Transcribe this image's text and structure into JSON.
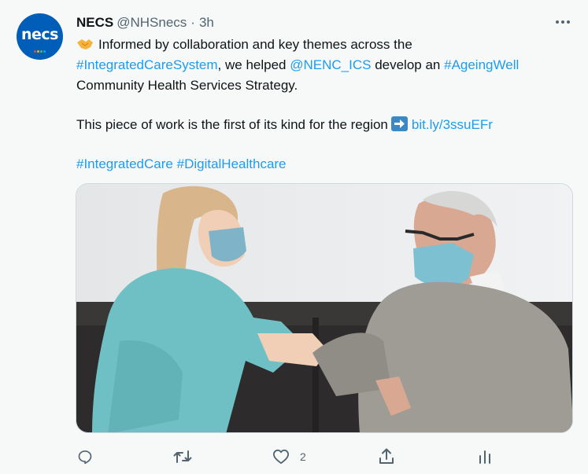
{
  "tweet": {
    "avatar_text": "necs",
    "author_name": "NECS",
    "handle": "@NHSnecs",
    "separator": "·",
    "time": "3h",
    "line1_text": "Informed by collaboration and key themes across the",
    "hashtag_ics": "#IntegratedCareSystem",
    "line2_mid": ", we helped ",
    "mention": "@NENC_ICS",
    "line2_mid2": " develop an ",
    "hashtag_ageing": "#AgeingWell",
    "line3_text": "Community Health Services Strategy.",
    "para2_text": "This piece of work is the first of its kind for the region",
    "link": "bit.ly/3ssuEFr",
    "hashtag_integrated": "#IntegratedCare",
    "hashtag_digital": "#DigitalHealthcare",
    "like_count": "2"
  },
  "icons": {
    "more": "more-horizontal-icon",
    "hands": "handshake-emoji",
    "arrow": "right-arrow-emoji",
    "reply": "reply-icon",
    "retweet": "retweet-icon",
    "like": "heart-icon",
    "share": "share-icon",
    "analytics": "analytics-icon"
  },
  "colors": {
    "link": "#1d9bf0",
    "text": "#0f1419",
    "muted": "#536471",
    "brand": "#005eb8",
    "background": "#f7f9f9"
  }
}
